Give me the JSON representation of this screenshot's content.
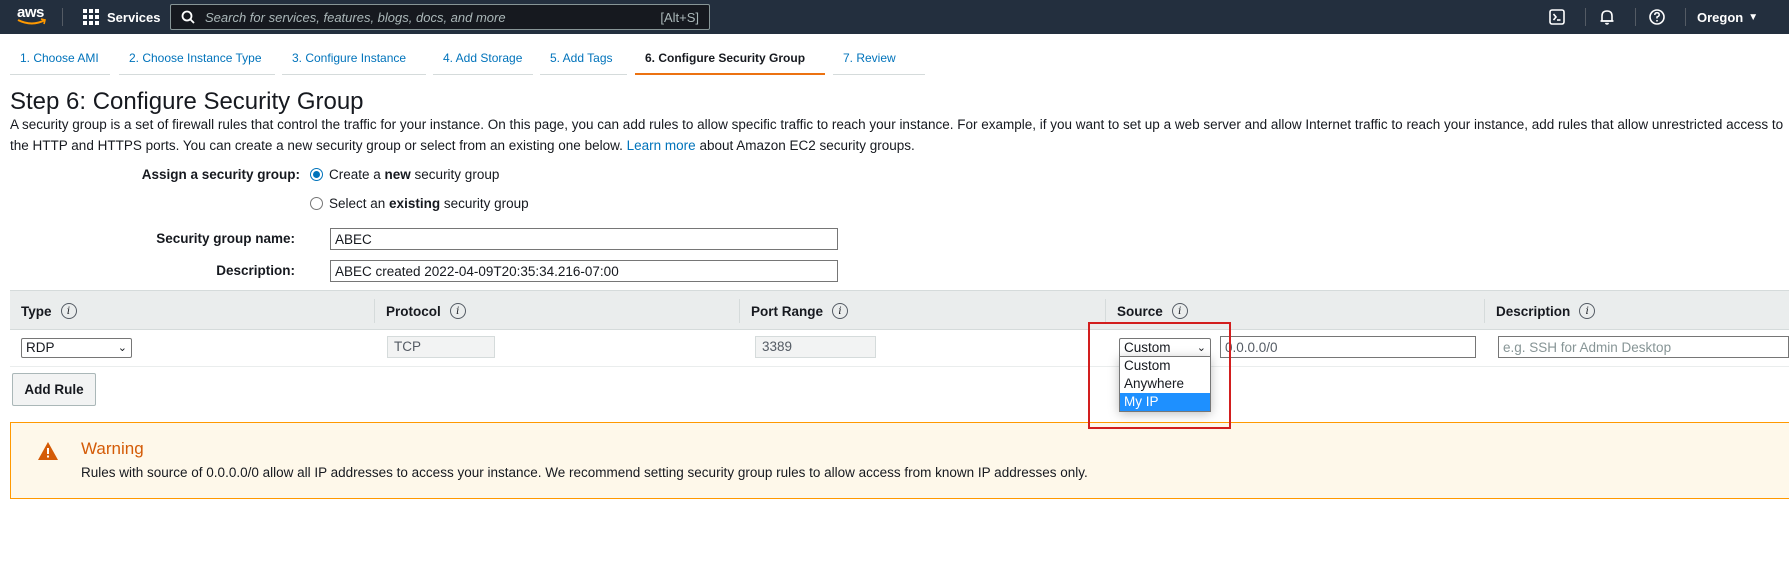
{
  "topnav": {
    "logo": "aws",
    "services_label": "Services",
    "search_placeholder": "Search for services, features, blogs, docs, and more",
    "search_shortcut": "[Alt+S]",
    "region": "Oregon",
    "icons": [
      "cloudshell-icon",
      "bell-icon",
      "help-icon"
    ]
  },
  "wizard": {
    "steps": [
      {
        "label": "1. Choose AMI"
      },
      {
        "label": "2. Choose Instance Type"
      },
      {
        "label": "3. Configure Instance"
      },
      {
        "label": "4. Add Storage"
      },
      {
        "label": "5. Add Tags"
      },
      {
        "label": "6. Configure Security Group",
        "active": true
      },
      {
        "label": "7. Review"
      }
    ]
  },
  "page": {
    "title": "Step 6: Configure Security Group",
    "intro_part1": "A security group is a set of firewall rules that control the traffic for your instance. On this page, you can add rules to allow specific traffic to reach your instance. For example, if you want to set up a web server and allow Internet traffic to reach your instance, add rules that allow unrestricted access to the",
    "intro_part2": "HTTP and HTTPS ports. You can create a new security group or select from an existing one below.",
    "learn_more": "Learn more",
    "intro_part3": "about Amazon EC2 security groups."
  },
  "form": {
    "assign_label": "Assign a security group:",
    "option_new_pre": "Create a ",
    "option_new_bold": "new",
    "option_new_post": " security group",
    "option_existing_pre": "Select an ",
    "option_existing_bold": "existing",
    "option_existing_post": " security group",
    "name_label": "Security group name:",
    "name_value": "ABEC",
    "desc_label": "Description:",
    "desc_value": "ABEC created 2022-04-09T20:35:34.216-07:00"
  },
  "rules_table": {
    "headers": [
      "Type",
      "Protocol",
      "Port Range",
      "Source",
      "Description"
    ],
    "info_glyph": "i",
    "row": {
      "type": "RDP",
      "protocol": "TCP",
      "port_range": "3389",
      "source_mode": "Custom",
      "source_cidr": "0.0.0.0/0",
      "description_placeholder": "e.g. SSH for Admin Desktop"
    }
  },
  "source_dropdown": {
    "options": [
      "Custom",
      "Anywhere",
      "My IP"
    ],
    "highlighted": "My IP"
  },
  "add_rule_label": "Add Rule",
  "warning": {
    "title": "Warning",
    "body": "Rules with source of 0.0.0.0/0 allow all IP addresses to access your instance. We recommend setting security group rules to allow access from known IP addresses only."
  },
  "colors": {
    "nav_bg": "#232f3e",
    "link": "#0073bb",
    "active_tab": "#ec7211",
    "warning_border": "#ff9900",
    "warning_title": "#d45b07",
    "highlight_box": "#d21e1e",
    "dropdown_highlight": "#1e90ff"
  }
}
